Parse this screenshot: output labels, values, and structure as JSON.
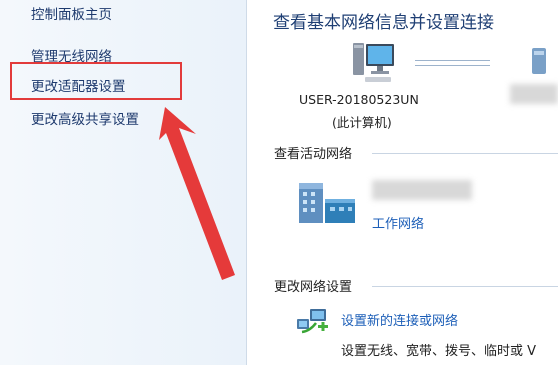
{
  "sidebar": {
    "items": [
      {
        "label": "控制面板主页"
      },
      {
        "label": "管理无线网络"
      },
      {
        "label": "更改适配器设置"
      },
      {
        "label": "更改高级共享设置"
      }
    ]
  },
  "main": {
    "title": "查看基本网络信息并设置连接",
    "computer": {
      "name": "USER-20180523UN",
      "sub": "(此计算机)"
    },
    "active_section": "查看活动网络",
    "network_type": "工作网络",
    "settings_section": "更改网络设置",
    "new_connection_link": "设置新的连接或网络",
    "new_connection_desc": "设置无线、宽带、拨号、临时或 V"
  },
  "colors": {
    "highlight": "#e23b3b",
    "link": "#1d5fb8",
    "heading": "#1f3f74"
  }
}
